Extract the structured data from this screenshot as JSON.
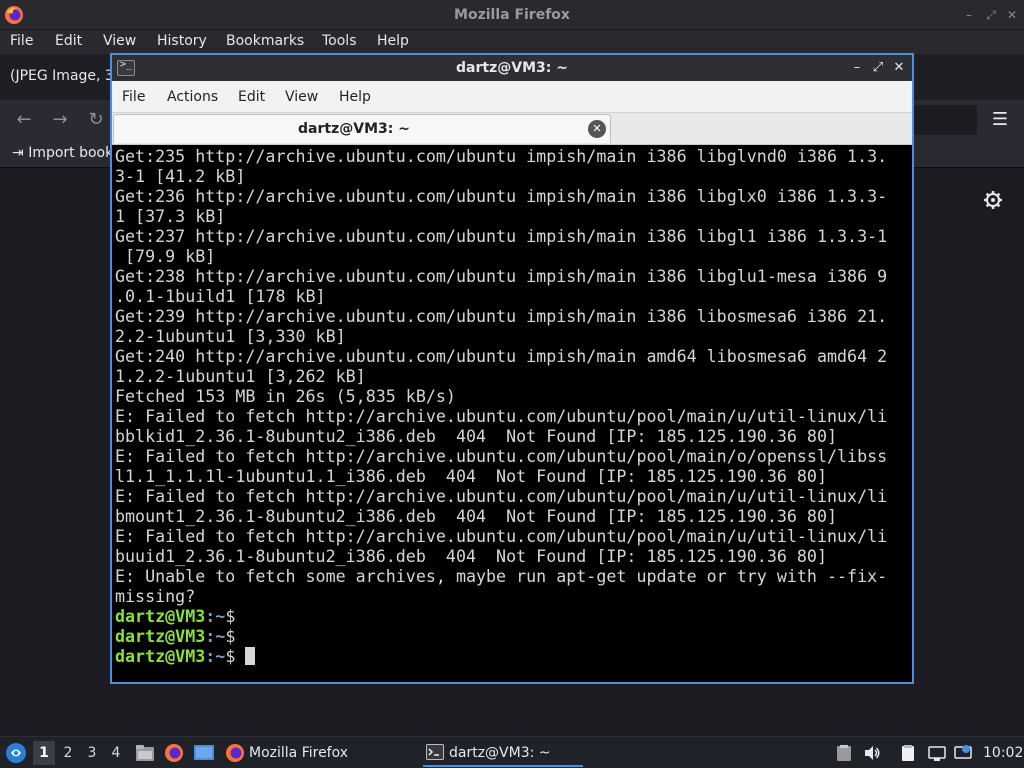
{
  "firefox": {
    "window_title": "Mozilla Firefox",
    "menu": [
      {
        "label": "File"
      },
      {
        "label": "Edit"
      },
      {
        "label": "View"
      },
      {
        "label": "History"
      },
      {
        "label": "Bookmarks"
      },
      {
        "label": "Tools"
      },
      {
        "label": "Help"
      }
    ],
    "tab_label": "(JPEG Image, 3",
    "bookmarks_import_label": "Import book"
  },
  "terminal": {
    "window_title": "dartz@VM3: ~",
    "menu": [
      {
        "label": "File"
      },
      {
        "label": "Actions"
      },
      {
        "label": "Edit"
      },
      {
        "label": "View"
      },
      {
        "label": "Help"
      }
    ],
    "tab_label": "dartz@VM3: ~",
    "output_lines": [
      "Get:235 http://archive.ubuntu.com/ubuntu impish/main i386 libglvnd0 i386 1.3.",
      "3-1 [41.2 kB]",
      "Get:236 http://archive.ubuntu.com/ubuntu impish/main i386 libglx0 i386 1.3.3-",
      "1 [37.3 kB]",
      "Get:237 http://archive.ubuntu.com/ubuntu impish/main i386 libgl1 i386 1.3.3-1",
      " [79.9 kB]",
      "Get:238 http://archive.ubuntu.com/ubuntu impish/main i386 libglu1-mesa i386 9",
      ".0.1-1build1 [178 kB]",
      "Get:239 http://archive.ubuntu.com/ubuntu impish/main i386 libosmesa6 i386 21.",
      "2.2-1ubuntu1 [3,330 kB]",
      "Get:240 http://archive.ubuntu.com/ubuntu impish/main amd64 libosmesa6 amd64 2",
      "1.2.2-1ubuntu1 [3,262 kB]",
      "Fetched 153 MB in 26s (5,835 kB/s)",
      "E: Failed to fetch http://archive.ubuntu.com/ubuntu/pool/main/u/util-linux/li",
      "bblkid1_2.36.1-8ubuntu2_i386.deb  404  Not Found [IP: 185.125.190.36 80]",
      "E: Failed to fetch http://archive.ubuntu.com/ubuntu/pool/main/o/openssl/libss",
      "l1.1_1.1.1l-1ubuntu1.1_i386.deb  404  Not Found [IP: 185.125.190.36 80]",
      "E: Failed to fetch http://archive.ubuntu.com/ubuntu/pool/main/u/util-linux/li",
      "bmount1_2.36.1-8ubuntu2_i386.deb  404  Not Found [IP: 185.125.190.36 80]",
      "E: Failed to fetch http://archive.ubuntu.com/ubuntu/pool/main/u/util-linux/li",
      "buuid1_2.36.1-8ubuntu2_i386.deb  404  Not Found [IP: 185.125.190.36 80]",
      "E: Unable to fetch some archives, maybe run apt-get update or try with --fix-",
      "missing?"
    ],
    "prompt_user": "dartz@VM3",
    "prompt_path": ":~",
    "prompt_symbol": "$",
    "prompt_count": 3
  },
  "taskbar": {
    "workspaces": [
      "1",
      "2",
      "3",
      "4"
    ],
    "active_workspace": "1",
    "tasks": [
      {
        "label": "Mozilla Firefox",
        "icon": "firefox-icon"
      },
      {
        "label": "dartz@VM3: ~",
        "icon": "terminal-icon"
      }
    ],
    "clock": "10:02"
  },
  "colors": {
    "terminal_border": "#4a90e2",
    "prompt_user": "#8ae234",
    "prompt_path": "#729fcf",
    "terminal_bg": "#000000",
    "terminal_fg": "#d6d6d6"
  }
}
